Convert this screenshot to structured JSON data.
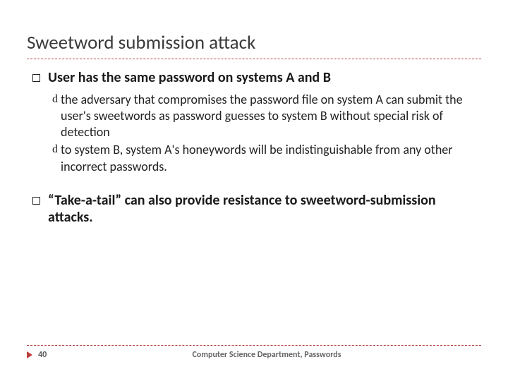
{
  "title": "Sweetword submission attack",
  "bullets": [
    {
      "level": 1,
      "text": "User has the same password on systems A and B"
    },
    {
      "level": 2,
      "text": "the adversary that compromises the password file on system A can submit the user's sweetwords as password guesses to system B without special risk of detection"
    },
    {
      "level": 2,
      "text": " to system B, system A's honeywords will be indistinguishable from any other incorrect passwords."
    },
    {
      "level": 1,
      "text": "“Take-a-tail” can also provide resistance to sweetword-submission attacks."
    }
  ],
  "footer": {
    "page": "40",
    "text": "Computer Science Department, Passwords"
  }
}
